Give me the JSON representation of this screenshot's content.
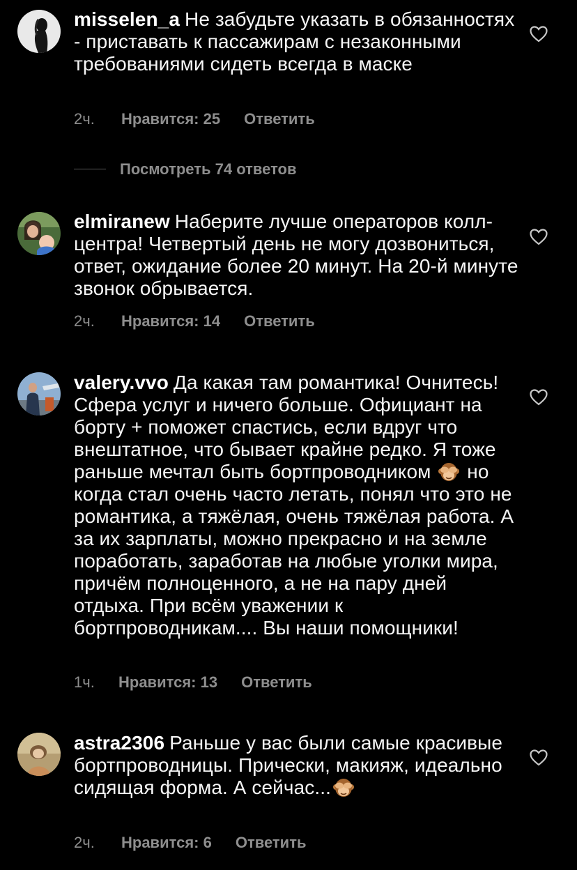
{
  "comments": [
    {
      "user": "misselen_a",
      "text": "Не забудьте указать в обязанностях - приставать к пассажирам с незаконными требованиями сидеть всегда в маске",
      "time": "2ч.",
      "likes": "Нравится: 25",
      "reply": "Ответить"
    },
    {
      "user": "elmiranew",
      "text": "Наберите лучше операторов колл-центра! Четвертый день не могу дозвониться, ответ, ожидание более 20 минут. На 20-й минуте звонок обрывается.",
      "time": "2ч.",
      "likes": "Нравится: 14",
      "reply": "Ответить"
    },
    {
      "user": "valery.vvo",
      "text_before_emoji": "Да какая там романтика! Очнитесь! Сфера услуг и ничего больше. Официант на борту + поможет спастись, если вдруг что внештатное, что бывает крайне редко. Я тоже раньше мечтал быть бортпроводником",
      "text_after_emoji": "но когда стал очень часто летать, понял что это не романтика, а тяжёлая, очень тяжёлая работа. А за их зарплаты, можно прекрасно и на земле поработать, заработав на любые уголки мира, причём полноценного, а не на пару дней отдыха. При всём уважении к бортпроводникам.... Вы наши помощники!",
      "emoji": "see-no-evil-monkey",
      "time": "1ч.",
      "likes": "Нравится: 13",
      "reply": "Ответить"
    },
    {
      "user": "astra2306",
      "text": "Раньше у вас были самые красивые бортпроводницы. Прически, макияж, идеально сидящая форма. А сейчас...",
      "emoji": "see-no-evil-monkey",
      "time": "2ч.",
      "likes": "Нравится: 6",
      "reply": "Ответить"
    }
  ],
  "view_replies": "Посмотреть 74 ответов",
  "colors": {
    "background": "#000000",
    "text": "#f5f5f5",
    "muted": "#8e8e8e"
  }
}
